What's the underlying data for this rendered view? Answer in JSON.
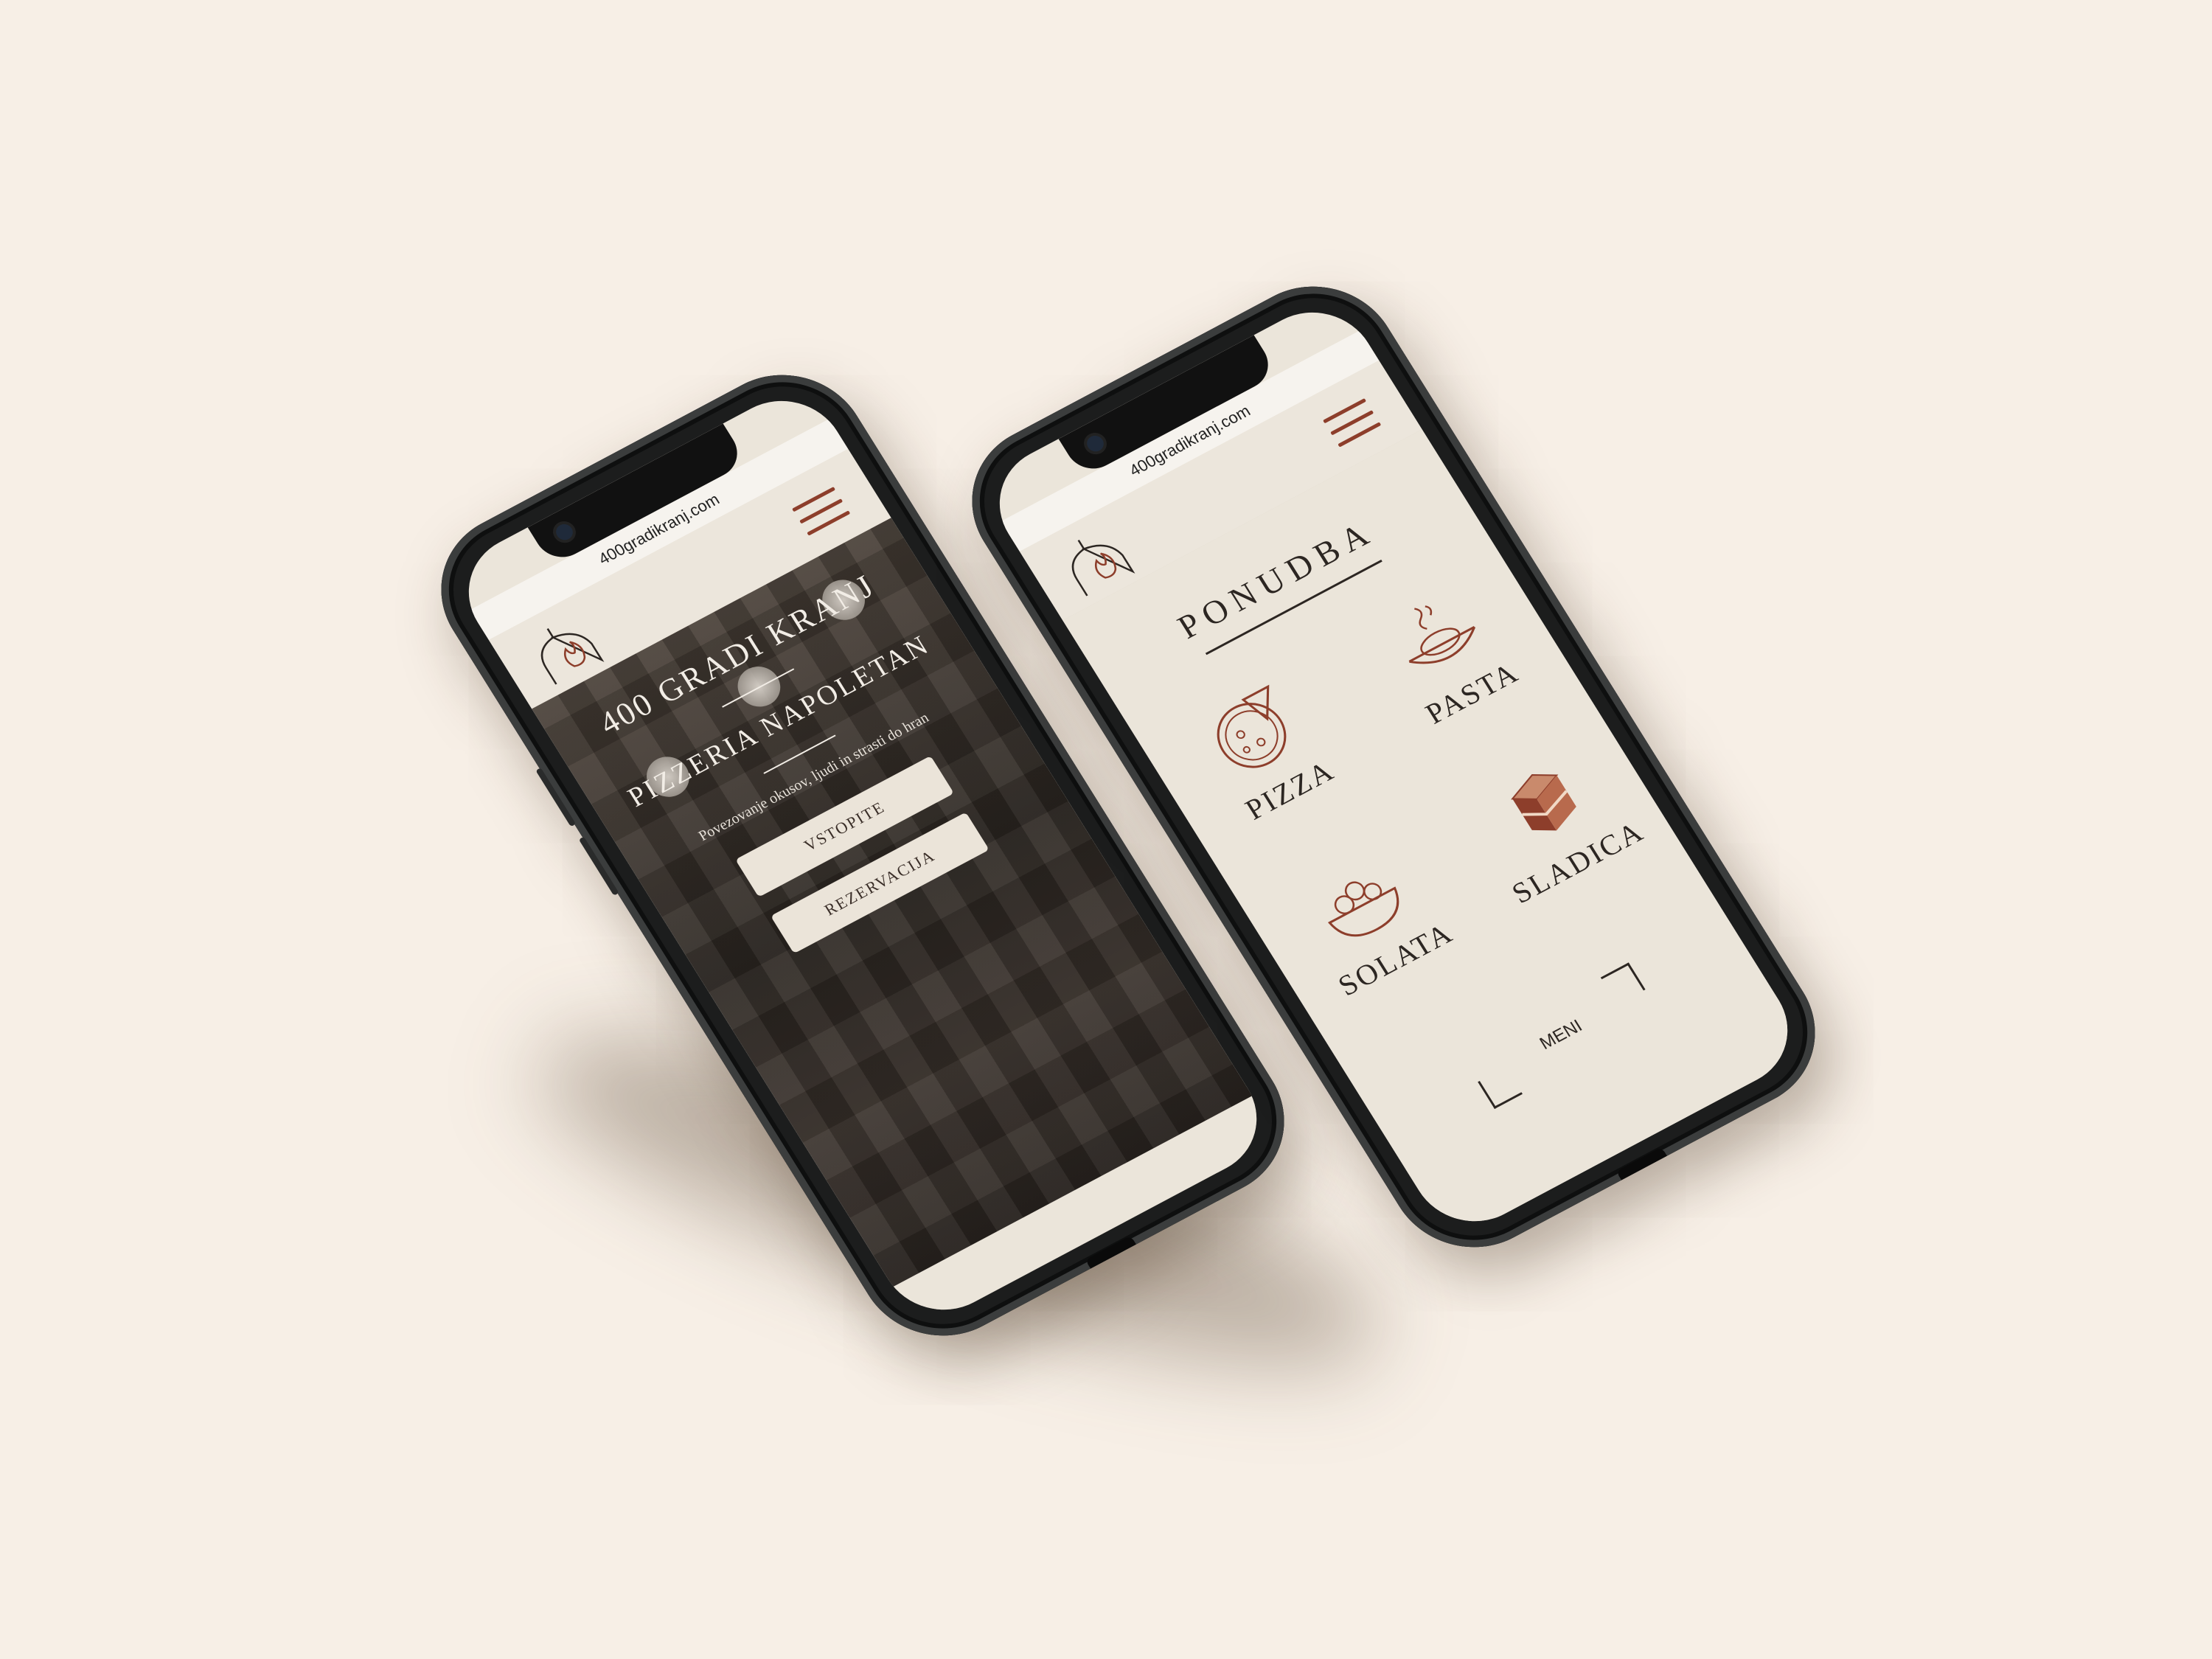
{
  "phones": [
    {
      "url": "400gradikranj.com",
      "hero": {
        "title_line1": "400 GRADI KRANJ",
        "title_line2": "PIZZERIA NAPOLETAN",
        "tagline": "Povezovanje okusov, ljudi in strasti do hran",
        "buttons": [
          "VSTOPITE",
          "REZERVACIJA"
        ]
      }
    },
    {
      "url": "400gradikranj.com",
      "menu": {
        "heading": "PONUDBA",
        "categories": [
          {
            "label": "PIZZA",
            "icon": "pizza-icon"
          },
          {
            "label": "PASTA",
            "icon": "pasta-icon"
          },
          {
            "label": "SOLATA",
            "icon": "salad-icon"
          },
          {
            "label": "SLADICA",
            "icon": "cake-icon"
          }
        ],
        "meni_button": "MENI"
      }
    }
  ],
  "colors": {
    "background": "#f7efe6",
    "accent": "#8d3e2b",
    "screen_bg": "#ebe5da",
    "text": "#2c2622"
  }
}
